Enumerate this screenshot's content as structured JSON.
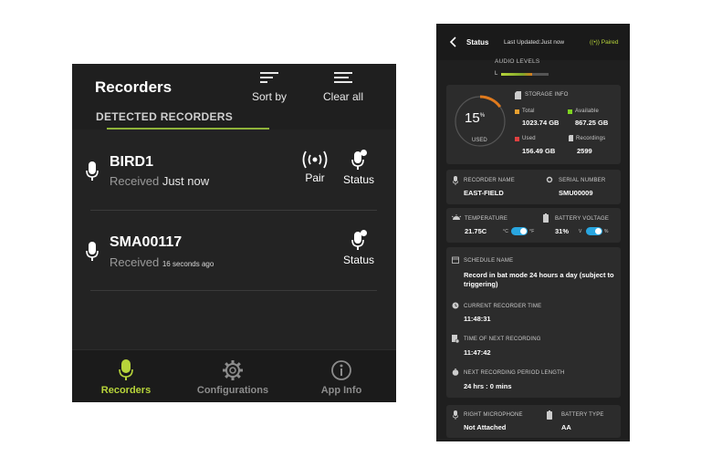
{
  "left": {
    "title": "Recorders",
    "sort_label": "Sort by",
    "clear_label": "Clear all",
    "section_label": "DETECTED RECORDERS",
    "recorders": [
      {
        "name": "BIRD1",
        "received_label": "Received",
        "received_time": "Just now",
        "pair_label": "Pair",
        "status_label": "Status"
      },
      {
        "name": "SMA00117",
        "received_label": "Received",
        "received_time": "16 seconds ago",
        "status_label": "Status"
      }
    ],
    "tabs": [
      {
        "label": "Recorders",
        "icon": "microphone-icon",
        "active": true
      },
      {
        "label": "Configurations",
        "icon": "gear-icon",
        "active": false
      },
      {
        "label": "App Info",
        "icon": "info-icon",
        "active": false
      }
    ]
  },
  "right": {
    "title": "Status",
    "last_updated": "Last Updated:Just now",
    "paired": "Paired",
    "audio_levels_label": "AUDIO LEVELS",
    "audio_channel": "L",
    "audio_level": 0.66,
    "storage": {
      "label": "STORAGE INFO",
      "percent": "15",
      "percent_sign": "%",
      "used_caption": "USED",
      "percent_value": 15,
      "total_label": "Total",
      "total_value": "1023.74 GB",
      "available_label": "Available",
      "available_value": "867.25 GB",
      "used_label": "Used",
      "used_value": "156.49 GB",
      "recordings_label": "Recordings",
      "recordings_value": "2599"
    },
    "recorder_name_label": "RECORDER NAME",
    "recorder_name": "EAST-FIELD",
    "serial_label": "SERIAL NUMBER",
    "serial_value": "SMU00009",
    "temperature_label": "TEMPERATURE",
    "temperature_value": "21.75C",
    "temp_unit_c": "°C",
    "temp_unit_f": "°F",
    "battery_voltage_label": "BATTERY VOLTAGE",
    "battery_voltage_value": "31%",
    "bv_unit_v": "V",
    "bv_unit_pct": "%",
    "schedule_label": "SCHEDULE NAME",
    "schedule_value": "Record in bat mode 24 hours a day (subject to triggering)",
    "current_time_label": "CURRENT RECORDER TIME",
    "current_time_value": "11:48:31",
    "next_recording_label": "TIME OF NEXT RECORDING",
    "next_recording_value": "11:47:42",
    "period_label": "NEXT RECORDING PERIOD LENGTH",
    "period_value": "24 hrs : 0 mins",
    "right_mic_label": "RIGHT MICROPHONE",
    "right_mic_value": "Not Attached",
    "battery_type_label": "BATTERY TYPE",
    "battery_type_value": "AA"
  },
  "colors": {
    "accent_green": "#b7d43a",
    "toggle_blue": "#29a6e0",
    "total_orange": "#e8a030",
    "available_green": "#7ed321",
    "used_red": "#e04040",
    "gauge_orange": "#e07a1d"
  }
}
